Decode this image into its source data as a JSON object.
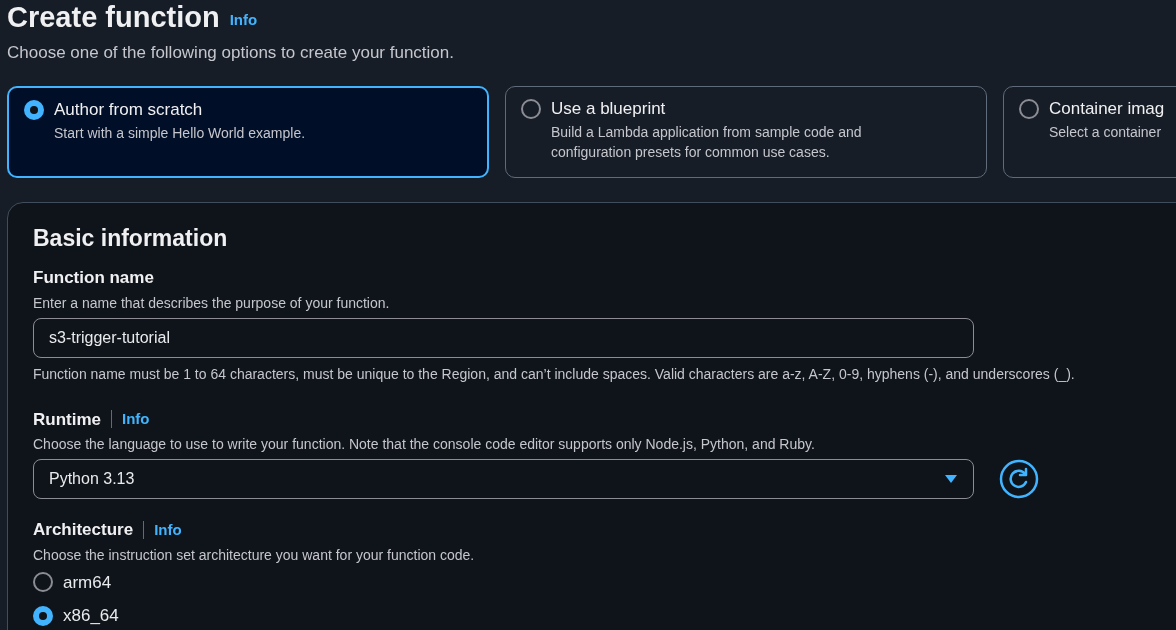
{
  "page": {
    "title": "Create function",
    "info_link": "Info",
    "description": "Choose one of the following options to create your function."
  },
  "options": [
    {
      "title": "Author from scratch",
      "description": "Start with a simple Hello World example.",
      "selected": true
    },
    {
      "title": "Use a blueprint",
      "description": "Build a Lambda application from sample code and configuration presets for common use cases.",
      "selected": false
    },
    {
      "title": "Container imag",
      "description": "Select a container",
      "selected": false
    }
  ],
  "basic_information": {
    "heading": "Basic information",
    "fields": [
      {
        "kind": "text",
        "label": "Function name",
        "description": "Enter a name that describes the purpose of your function.",
        "value": "s3-trigger-tutorial",
        "constraint": "Function name must be 1 to 64 characters, must be unique to the Region, and can’t include spaces. Valid characters are a-z, A-Z, 0-9, hyphens (-), and underscores (_)."
      },
      {
        "kind": "select",
        "label": "Runtime",
        "info_link": "Info",
        "description": "Choose the language to use to write your function. Note that the console code editor supports only Node.js, Python, and Ruby.",
        "value": "Python 3.13"
      },
      {
        "kind": "radio",
        "label": "Architecture",
        "info_link": "Info",
        "description": "Choose the instruction set architecture you want for your function code.",
        "options": [
          {
            "label": "arm64",
            "selected": false
          },
          {
            "label": "x86_64",
            "selected": true
          }
        ]
      }
    ]
  }
}
